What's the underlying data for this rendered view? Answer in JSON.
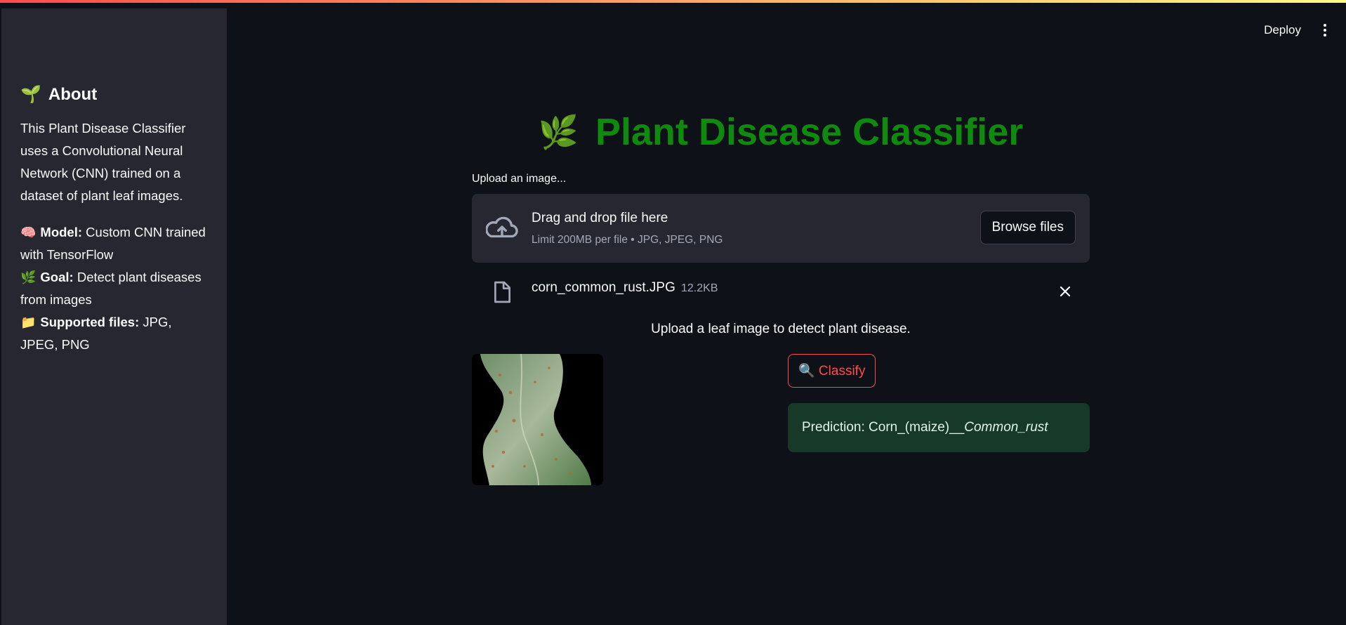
{
  "sidebar": {
    "about_icon": "🌱",
    "about_title": "About",
    "about_text": "This Plant Disease Classifier uses a Convolutional Neural Network (CNN) trained on a dataset of plant leaf images.",
    "model_icon": "🧠",
    "model_label": "Model:",
    "model_value": " Custom CNN trained with TensorFlow",
    "goal_icon": "🌿",
    "goal_label": "Goal:",
    "goal_value": " Detect plant diseases from images",
    "files_icon": "📁",
    "files_label": "Supported files:",
    "files_value": " JPG, JPEG, PNG"
  },
  "header": {
    "deploy_label": "Deploy",
    "menu_icon": "more-vertical-icon"
  },
  "main": {
    "title_icon": "🌿",
    "title": "Plant Disease Classifier",
    "upload_label": "Upload an image...",
    "dropzone_title": "Drag and drop file here",
    "dropzone_sub": "Limit 200MB per file • JPG, JPEG, PNG",
    "browse_label": "Browse files",
    "file_name": "corn_common_rust.JPG",
    "file_size": "12.2KB",
    "instruction": "Upload a leaf image to detect plant disease.",
    "classify_label": "🔍 Classify",
    "prediction_prefix": "Prediction: Corn_(maize)__",
    "prediction_disease": "Common_rust"
  },
  "colors": {
    "accent": "#ff4b4b",
    "title_green": "#0f8a0f",
    "success_bg": "#173928",
    "background": "#0e1117",
    "sidebar_bg": "#262730"
  }
}
